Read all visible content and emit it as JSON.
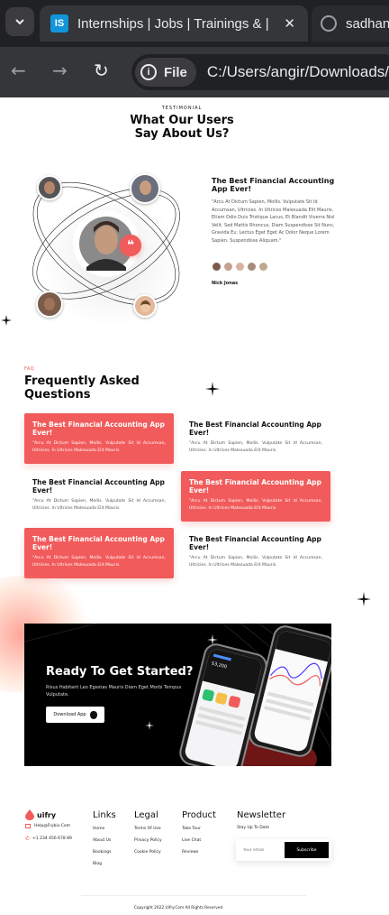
{
  "browser": {
    "active_tab_title": "Internships | Jobs | Trainings & |",
    "active_tab_favicon": "IS",
    "inactive_tab_title": "sadhan",
    "site_chip": "File",
    "url": "C:/Users/angir/Downloads/",
    "accent": "#1295db"
  },
  "testimonial": {
    "eyebrow": "TESTIMONIAL",
    "heading_line1": "What Our Users",
    "heading_line2": "Say About Us?",
    "title": "The Best Financial Accounting App Ever!",
    "body": "\"Arcu At Dictum Sapien, Mollis. Vulputate Sit Id Accumsan, Ultricies. In Ultrices Malesuada Elit Mauris. Etiam Odio Duis Tristique Lacus, Et Blandit Viverra Nisl Velit. Sed Mattis Rhoncus, Diam Suspendisse Sit Nunc, Gravida Eu. Lectus Eget Eget Ac Dolor Neque Lorem Sapien. Suspendisse Aliquam.\"",
    "author": "Nick Jonas",
    "quote_badge": "❝",
    "accent": "#f15b5b"
  },
  "faq": {
    "eyebrow": "FAQ",
    "heading_line1": "Frequently Asked",
    "heading_line2": "Questions",
    "items": [
      {
        "q": "The Best Financial Accounting App Ever!",
        "a": "\"Arcu At Dictum Sapien, Mollis. Vulputate Sit Id Accumsan, Ultricies. In Ultrices Malesuada Elit Mauris."
      },
      {
        "q": "The Best Financial Accounting App Ever!",
        "a": "\"Arcu At Dictum Sapien, Mollis. Vulputate Sit Id Accumsan, Ultricies. In Ultrices Malesuada Elit Mauris."
      },
      {
        "q": "The Best Financial Accounting App Ever!",
        "a": "\"Arcu At Dictum Sapien, Mollis. Vulputate Sit Id Accumsan, Ultricies. In Ultrices Malesuada Elit Mauris."
      },
      {
        "q": "The Best Financial Accounting App Ever!",
        "a": "\"Arcu At Dictum Sapien, Mollis. Vulputate Sit Id Accumsan, Ultricies. In Ultrices Malesuada Elit Mauris."
      },
      {
        "q": "The Best Financial Accounting App Ever!",
        "a": "\"Arcu At Dictum Sapien, Mollis. Vulputate Sit Id Accumsan, Ultricies. In Ultrices Malesuada Elit Mauris."
      },
      {
        "q": "The Best Financial Accounting App Ever!",
        "a": "\"Arcu At Dictum Sapien, Mollis. Vulputate Sit Id Accumsan, Ultricies. In Ultrices Malesuada Elit Mauris."
      }
    ],
    "highlight_color": "#f15b5b"
  },
  "cta": {
    "heading": "Ready To Get Started?",
    "body": "Risus Habitant Leo Egestas Mauris Diam Eget Morbi Tempus Vulputate.",
    "button_label": "Download App",
    "phone_balance": "$3,200"
  },
  "footer": {
    "brand": "uifry",
    "email": "Help@Frybix.Com",
    "phone": "+1 234 456 678 89",
    "links_heading": "Links",
    "links": [
      "Home",
      "About Us",
      "Bookings",
      "Blog"
    ],
    "legal_heading": "Legal",
    "legal": [
      "Terms Of Use",
      "Privacy Policy",
      "Cookie Policy"
    ],
    "product_heading": "Product",
    "product": [
      "Take Tour",
      "Live Chat",
      "Reviews"
    ],
    "newsletter_heading": "Newsletter",
    "newsletter_sub": "Stay Up To Date",
    "email_placeholder": "Your email",
    "subscribe_label": "Subscribe",
    "copyright": "Copyright 2022 Uifry.Com All Rights Reserved"
  }
}
